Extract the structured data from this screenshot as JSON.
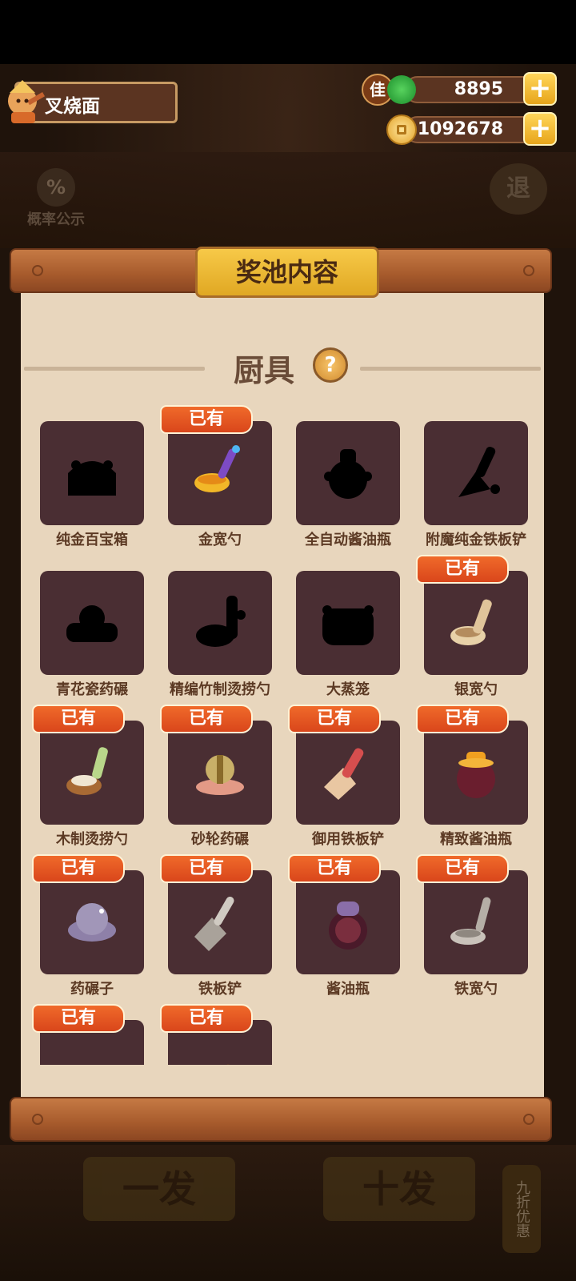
{
  "player": {
    "name": "叉烧面"
  },
  "resources": {
    "premium": {
      "icon": "jade-token-icon",
      "glyph": "佳",
      "value": "8895"
    },
    "coins": {
      "icon": "coin-icon",
      "value": "1092678"
    },
    "plus_label": "+"
  },
  "top_buttons": {
    "probability_label": "概率公示",
    "probability_glyph": "%",
    "exit_label": "退"
  },
  "panel": {
    "title": "奖池内容",
    "category": "厨具",
    "help_glyph": "?"
  },
  "owned_label": "已有",
  "items": [
    {
      "name": "纯金百宝箱",
      "owned": false,
      "icon": "treasure-chest-silhouette-icon"
    },
    {
      "name": "金宽勺",
      "owned": true,
      "icon": "gold-ladle-icon"
    },
    {
      "name": "全自动酱油瓶",
      "owned": false,
      "icon": "auto-soy-bottle-silhouette-icon"
    },
    {
      "name": "附魔纯金铁板铲",
      "owned": false,
      "icon": "enchanted-spatula-silhouette-icon"
    },
    {
      "name": "青花瓷药碾",
      "owned": false,
      "icon": "porcelain-grinder-silhouette-icon"
    },
    {
      "name": "精编竹制烫捞勺",
      "owned": false,
      "icon": "bamboo-strainer-silhouette-icon"
    },
    {
      "name": "大蒸笼",
      "owned": false,
      "icon": "steamer-silhouette-icon"
    },
    {
      "name": "银宽勺",
      "owned": true,
      "icon": "silver-ladle-icon"
    },
    {
      "name": "木制烫捞勺",
      "owned": true,
      "icon": "wooden-strainer-icon"
    },
    {
      "name": "砂轮药碾",
      "owned": true,
      "icon": "grinding-wheel-icon"
    },
    {
      "name": "御用铁板铲",
      "owned": true,
      "icon": "royal-spatula-icon"
    },
    {
      "name": "精致酱油瓶",
      "owned": true,
      "icon": "fine-soy-bottle-icon"
    },
    {
      "name": "药碾子",
      "owned": true,
      "icon": "grinder-icon"
    },
    {
      "name": "铁板铲",
      "owned": true,
      "icon": "iron-spatula-icon"
    },
    {
      "name": "酱油瓶",
      "owned": true,
      "icon": "soy-bottle-icon"
    },
    {
      "name": "铁宽勺",
      "owned": true,
      "icon": "iron-ladle-icon"
    },
    {
      "name": "",
      "owned": true,
      "icon": "barrel-icon"
    },
    {
      "name": "",
      "owned": true,
      "icon": "mortar-icon"
    }
  ],
  "bottom_buttons": {
    "single": "一发",
    "ten": "十发",
    "discount": "九折优惠"
  },
  "colors": {
    "accent": "#e7a51b",
    "tag": "#e0521f",
    "slot": "#4a2e33",
    "paper": "#e8d6bd"
  }
}
